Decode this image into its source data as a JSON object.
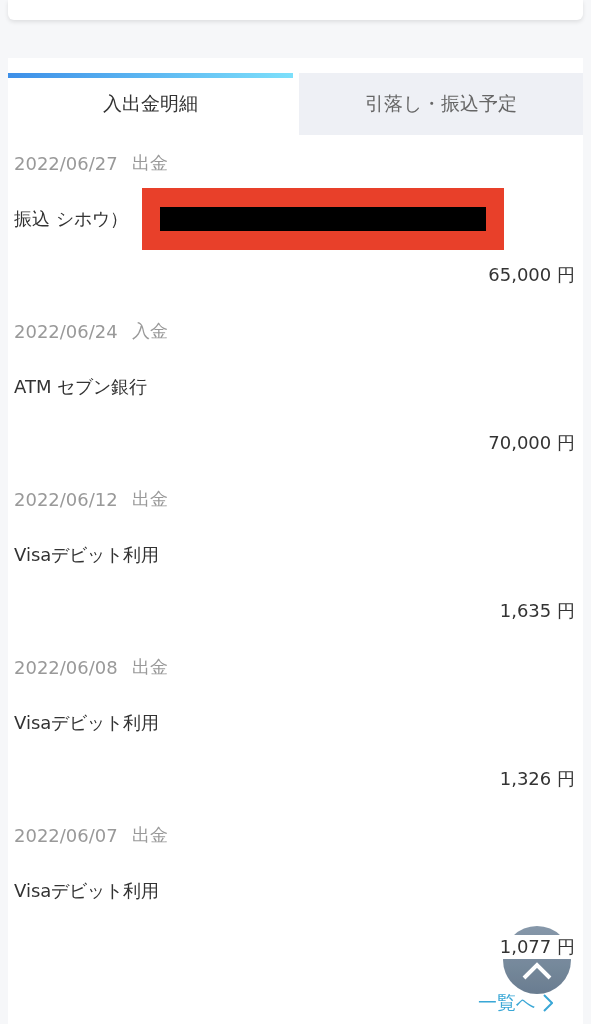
{
  "tabs": [
    {
      "label": "入出金明細",
      "selected": true
    },
    {
      "label": "引落し・振込予定",
      "selected": false
    }
  ],
  "transactions": [
    {
      "date": "2022/06/27",
      "type": "出金",
      "description": "振込 シホウ）",
      "redacted": true,
      "amount": "65,000 円"
    },
    {
      "date": "2022/06/24",
      "type": "入金",
      "description": "ATM セブン銀行",
      "redacted": false,
      "amount": "70,000 円"
    },
    {
      "date": "2022/06/12",
      "type": "出金",
      "description": "Visaデビット利用",
      "redacted": false,
      "amount": "1,635 円"
    },
    {
      "date": "2022/06/08",
      "type": "出金",
      "description": "Visaデビット利用",
      "redacted": false,
      "amount": "1,326 円"
    },
    {
      "date": "2022/06/07",
      "type": "出金",
      "description": "Visaデビット利用",
      "redacted": false,
      "amount": "1,077 円"
    }
  ],
  "more_link": "一覧へ"
}
